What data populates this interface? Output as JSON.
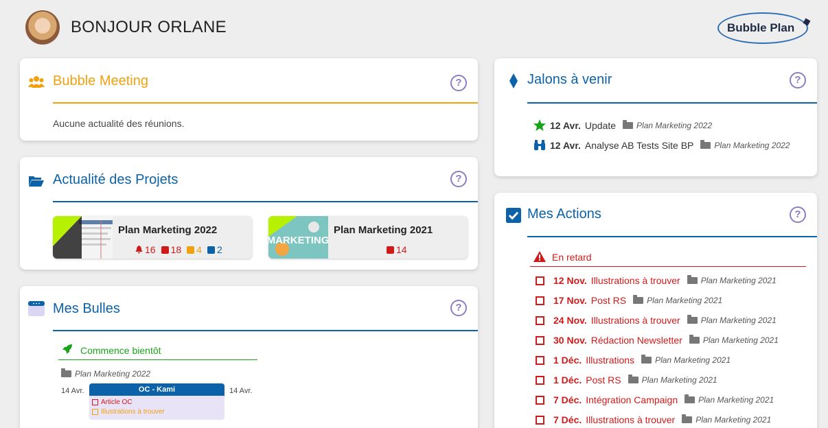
{
  "header": {
    "greeting": "BONJOUR ORLANE",
    "logo_text": "Bubble Plan"
  },
  "meeting": {
    "title": "Bubble Meeting",
    "empty": "Aucune actualité des réunions.",
    "help": "?"
  },
  "projets": {
    "title": "Actualité des Projets",
    "help": "?",
    "items": [
      {
        "name": "Plan Marketing 2022",
        "alerts": "16",
        "tasks": "18",
        "todo": "4",
        "events": "2"
      },
      {
        "name": "Plan Marketing 2021",
        "tasks": "14",
        "thumb_text": "MARKETING"
      }
    ]
  },
  "bulles": {
    "title": "Mes Bulles",
    "help": "?",
    "soon_label": "Commence bientôt",
    "project": "Plan Marketing 2022",
    "date_start": "14 Avr.",
    "date_end": "14 Avr.",
    "bubble_title": "OC - Kami",
    "items": [
      "Article OC",
      "Illustrations à trouver"
    ]
  },
  "jalons": {
    "title": "Jalons à venir",
    "help": "?",
    "items": [
      {
        "date": "12 Avr.",
        "name": "Update",
        "project": "Plan Marketing 2022",
        "icon": "star-icon"
      },
      {
        "date": "12 Avr.",
        "name": "Analyse AB Tests Site BP",
        "project": "Plan Marketing 2022",
        "icon": "binoculars-icon"
      }
    ]
  },
  "actions": {
    "title": "Mes Actions",
    "help": "?",
    "late_label": "En retard",
    "items": [
      {
        "date": "12 Nov.",
        "name": "Illustrations à trouver",
        "project": "Plan Marketing 2021"
      },
      {
        "date": "17 Nov.",
        "name": "Post RS",
        "project": "Plan Marketing 2021"
      },
      {
        "date": "24 Nov.",
        "name": "Illustrations à trouver",
        "project": "Plan Marketing 2021"
      },
      {
        "date": "30 Nov.",
        "name": "Rédaction Newsletter",
        "project": "Plan Marketing 2021"
      },
      {
        "date": "1 Déc.",
        "name": "Illustrations",
        "project": "Plan Marketing 2021"
      },
      {
        "date": "1 Déc.",
        "name": "Post RS",
        "project": "Plan Marketing 2021"
      },
      {
        "date": "7 Déc.",
        "name": "Intégration Campaign",
        "project": "Plan Marketing 2021"
      },
      {
        "date": "7 Déc.",
        "name": "Illustrations à trouver",
        "project": "Plan Marketing 2021"
      }
    ]
  },
  "colors": {
    "accent_blue": "#0b62a8",
    "orange": "#f0a10e",
    "red": "#d01a1a",
    "green": "#1aa31a",
    "help_purple": "#8e7cc3"
  }
}
